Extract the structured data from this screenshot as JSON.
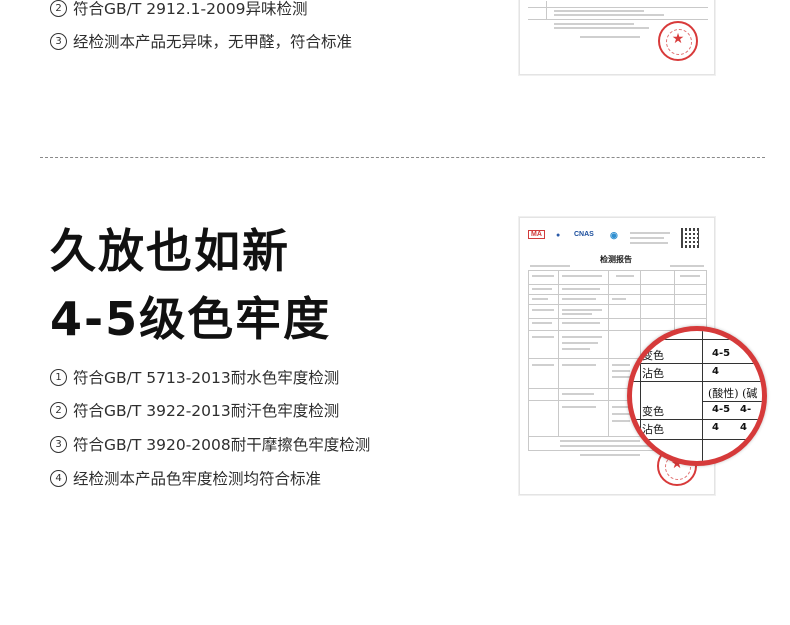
{
  "top": {
    "items": [
      {
        "num": "2",
        "text": "符合GB/T 2912.1-2009异味检测"
      },
      {
        "num": "3",
        "text": "经检测本产品无异味，无甲醛，符合标准"
      }
    ]
  },
  "bottom": {
    "headline1": "久放也如新",
    "headline2": "4-5级色牢度",
    "items": [
      {
        "num": "1",
        "text": "符合GB/T 5713-2013耐水色牢度检测"
      },
      {
        "num": "2",
        "text": "符合GB/T 3922-2013耐汗色牢度检测"
      },
      {
        "num": "3",
        "text": "符合GB/T 3920-2008耐干摩擦色牢度检测"
      },
      {
        "num": "4",
        "text": "经检测本产品色牢度检测均符合标准"
      }
    ]
  },
  "report": {
    "title": "检测报告",
    "logos": {
      "ma": "MA",
      "cnas": "CNAS"
    }
  },
  "magnifier": {
    "row1_label": "变色",
    "row1_value": "4-5",
    "row2_label": "沾色",
    "row2_value": "4",
    "header": "(酸性) (碱",
    "row3_label": "变色",
    "row3_value": "4-5",
    "row3_value2": "4-",
    "row4_label": "沾色",
    "row4_value": "4",
    "row4_value2": "4"
  },
  "colors": {
    "stamp": "#d83a3a",
    "magnifier_border": "#d63a3a"
  }
}
